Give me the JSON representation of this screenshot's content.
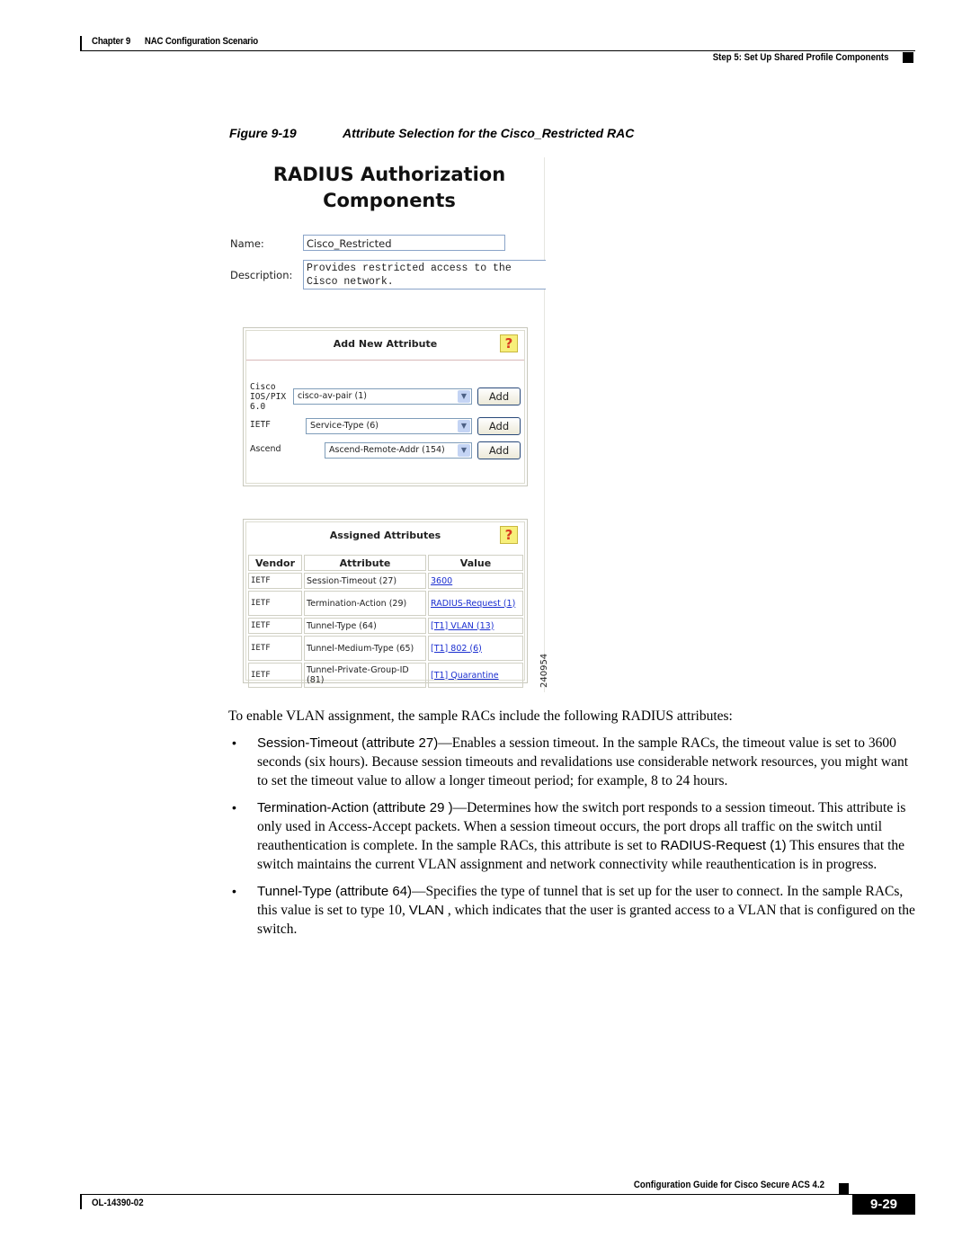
{
  "header": {
    "chapter": "Chapter 9",
    "chapter_title": "NAC Configuration Scenario",
    "section": "Step 5: Set Up Shared Profile Components"
  },
  "figure": {
    "number": "Figure 9-19",
    "caption": "Attribute Selection for the Cisco_Restricted RAC",
    "id": "240954",
    "screen": {
      "title_line1": "RADIUS Authorization",
      "title_line2": "Components",
      "name_label": "Name:",
      "name_value": "Cisco_Restricted",
      "description_label": "Description:",
      "description_value": "Provides restricted access to the\nCisco network.",
      "add_panel": {
        "title": "Add New Attribute",
        "help_icon": "question-mark-icon",
        "rows": [
          {
            "vendor_line1": "Cisco",
            "vendor_line2": "IOS/PIX",
            "vendor_line3": "6.0",
            "selected": "cisco-av-pair (1)",
            "button": "Add"
          },
          {
            "vendor_line1": "IETF",
            "selected": "Service-Type (6)",
            "button": "Add"
          },
          {
            "vendor_line1": "Ascend",
            "selected": "Ascend-Remote-Addr (154)",
            "button": "Add"
          }
        ]
      },
      "assigned_panel": {
        "title": "Assigned Attributes",
        "help_icon": "question-mark-icon",
        "columns": [
          "Vendor",
          "Attribute",
          "Value"
        ],
        "rows": [
          {
            "vendor": "IETF",
            "attribute": "Session-Timeout (27)",
            "value": "3600"
          },
          {
            "vendor": "IETF",
            "attribute": "Termination-Action (29)",
            "value": "RADIUS-Request (1)"
          },
          {
            "vendor": "IETF",
            "attribute": "Tunnel-Type (64)",
            "value": "[T1] VLAN (13)"
          },
          {
            "vendor": "IETF",
            "attribute": "Tunnel-Medium-Type (65)",
            "value": "[T1] 802 (6)"
          },
          {
            "vendor": "IETF",
            "attribute": "Tunnel-Private-Group-ID (81)",
            "value": "[T1] Quarantine"
          }
        ]
      }
    }
  },
  "body": {
    "intro": "To enable VLAN assignment, the sample RACs include the following RADIUS attributes:",
    "bullets": [
      {
        "term": "Session-Timeout (attribute 27)",
        "text": "—Enables a session timeout. In the sample RACs, the timeout value is set to 3600 seconds (six hours). Because session timeouts and revalidations use considerable network resources, you might want to set the timeout value to allow a longer timeout period; for example, 8 to 24 hours."
      },
      {
        "term": "Termination-Action (attribute 29 )",
        "text_before": "—Determines how the switch port responds to a session timeout. This attribute is only used in Access-Accept packets. When a session timeout occurs, the port drops all traffic on the switch until reauthentication is complete. In the sample RACs, this attribute is set to ",
        "inline_term": "RADIUS-Request (1)",
        "text_after": " This ensures that the switch maintains the current VLAN assignment and network connectivity while reauthentication is in progress."
      },
      {
        "term": "Tunnel-Type (attribute 64)",
        "text_before": "—Specifies the type of tunnel that is set up for the user to connect. In the sample RACs, this value is set to type 10, ",
        "inline_term": "VLAN",
        "text_after": " , which indicates that the user is granted access to a VLAN that is configured on the switch."
      }
    ]
  },
  "footer": {
    "guide_title": "Configuration Guide for Cisco Secure ACS 4.2",
    "doc_number": "OL-14390-02",
    "page_number": "9-29"
  }
}
